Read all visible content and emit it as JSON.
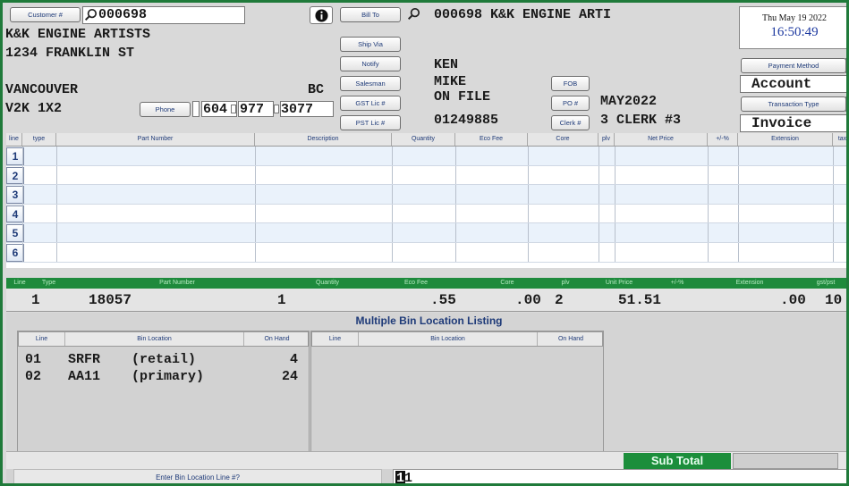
{
  "customer": {
    "button": "Customer #",
    "number": "000698",
    "name": "K&K ENGINE ARTISTS",
    "street": "1234 FRANKLIN ST",
    "city": "VANCOUVER",
    "province": "BC",
    "postal": "V2K 1X2",
    "phone_button": "Phone",
    "phone_area": "604",
    "phone_prefix": "977",
    "phone_line": "3077"
  },
  "order_buttons": {
    "bill_to": "Bill To",
    "ship_via": "Ship Via",
    "notify": "Notify",
    "salesman": "Salesman",
    "gst_lic": "GST Lic #",
    "pst_lic": "PST Lic #",
    "fob": "FOB",
    "po": "PO #",
    "clerk": "Clerk #"
  },
  "order_values": {
    "bill_to": "000698 K&K ENGINE ARTI",
    "notify": "KEN",
    "salesman": "MIKE",
    "gst_lic": "ON FILE",
    "pst_lic": "01249885",
    "po": "MAY2022",
    "clerk": "3 CLERK #3"
  },
  "datetime": {
    "date": "Thu May 19 2022",
    "time": "16:50:49"
  },
  "payment": {
    "label": "Payment Method",
    "value": "Account"
  },
  "transaction": {
    "label": "Transaction Type",
    "value": "Invoice"
  },
  "line_grid": {
    "headers": [
      "line",
      "type",
      "Part Number",
      "Description",
      "Quantity",
      "Eco Fee",
      "Core",
      "plv",
      "Net Price",
      "+/-%",
      "Extension",
      "tax"
    ],
    "rows": [
      "1",
      "2",
      "3",
      "4",
      "5",
      "6"
    ]
  },
  "current_line": {
    "headers": [
      "Line",
      "Type",
      "Part Number",
      "Quantity",
      "Eco Fee",
      "Core",
      "plv",
      "Unit Price",
      "+/-%",
      "Extension",
      "gst/pst"
    ],
    "line": "1",
    "part": "18057",
    "quantity": "1",
    "eco_fee": ".55",
    "core": ".00",
    "plv": "2",
    "unit_price": "51.51",
    "extension": ".00",
    "tax": "10"
  },
  "bin_listing": {
    "title": "Multiple Bin Location Listing",
    "headers": [
      "Line",
      "Bin Location",
      "On Hand"
    ],
    "left_rows": [
      {
        "line": "01",
        "bin": "SRFR",
        "desc": "(retail)",
        "on_hand": "4"
      },
      {
        "line": "02",
        "bin": "AA11",
        "desc": "(primary)",
        "on_hand": "24"
      }
    ]
  },
  "subtotal_label": "Sub Total",
  "prompt": {
    "label": "Enter Bin Location Line #?",
    "value": "1",
    "cursor": "1"
  },
  "colors": {
    "frame_green": "#1f7a3a",
    "header_green": "#1e8a3c",
    "label_blue": "#1e3a78"
  },
  "icons": {
    "lookup": "magnifier-icon",
    "info": "info-icon"
  }
}
